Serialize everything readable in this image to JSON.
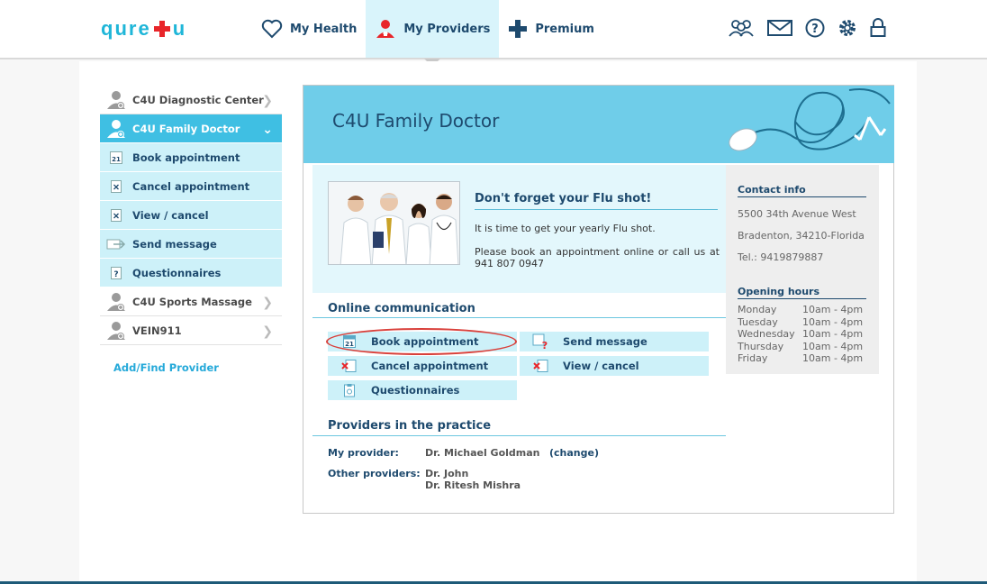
{
  "brand": {
    "logo_left": "qure",
    "logo_right": "u"
  },
  "nav": [
    {
      "label": "My Health",
      "icon": "heart-icon"
    },
    {
      "label": "My Providers",
      "icon": "doctor-icon",
      "active": true
    },
    {
      "label": "Premium",
      "icon": "premium-cross-icon"
    }
  ],
  "tools": [
    "group-icon",
    "mail-icon",
    "help-icon",
    "gear-icon",
    "lock-icon"
  ],
  "sidebar": {
    "items": [
      {
        "label": "C4U Diagnostic Center"
      },
      {
        "label": "C4U Family Doctor",
        "active": true
      },
      {
        "label": "C4U Sports Massage"
      },
      {
        "label": "VEIN911"
      }
    ],
    "sub_items": [
      {
        "label": "Book appointment"
      },
      {
        "label": "Cancel appointment"
      },
      {
        "label": "View / cancel"
      },
      {
        "label": "Send message"
      },
      {
        "label": "Questionnaires"
      }
    ],
    "add_provider": "Add/Find Provider"
  },
  "banner": {
    "title": "C4U Family Doctor"
  },
  "flu": {
    "title": "Don't forget your Flu shot!",
    "line1": "It is time to get your yearly Flu shot.",
    "line2": "Please book an appointment online or call us at 941 807 0947"
  },
  "contact": {
    "heading": "Contact info",
    "address1": "5500 34th Avenue West",
    "address2": "Bradenton, 34210-Florida",
    "phone": "Tel.: 9419879887",
    "hours_heading": "Opening hours",
    "hours": [
      {
        "day": "Monday",
        "time": "10am - 4pm"
      },
      {
        "day": "Tuesday",
        "time": "10am - 4pm"
      },
      {
        "day": "Wednesday",
        "time": "10am - 4pm"
      },
      {
        "day": "Thursday",
        "time": "10am - 4pm"
      },
      {
        "day": "Friday",
        "time": "10am - 4pm"
      }
    ]
  },
  "online": {
    "heading": "Online communication",
    "book": "Book appointment",
    "send": "Send message",
    "cancel": "Cancel appointment",
    "view": "View / cancel",
    "questionnaires": "Questionnaires"
  },
  "providers": {
    "heading": "Providers in the practice",
    "my_label": "My provider:",
    "my_value": "Dr. Michael Goldman",
    "change": "(change)",
    "other_label": "Other providers:",
    "other_1": "Dr. John",
    "other_2": "Dr. Ritesh Mishra"
  },
  "colors": {
    "accent": "#3fbfe3",
    "light": "#cdf1f9",
    "navy": "#1e4a6e",
    "brand_red": "#e8252a",
    "highlight": "#d9403b"
  }
}
